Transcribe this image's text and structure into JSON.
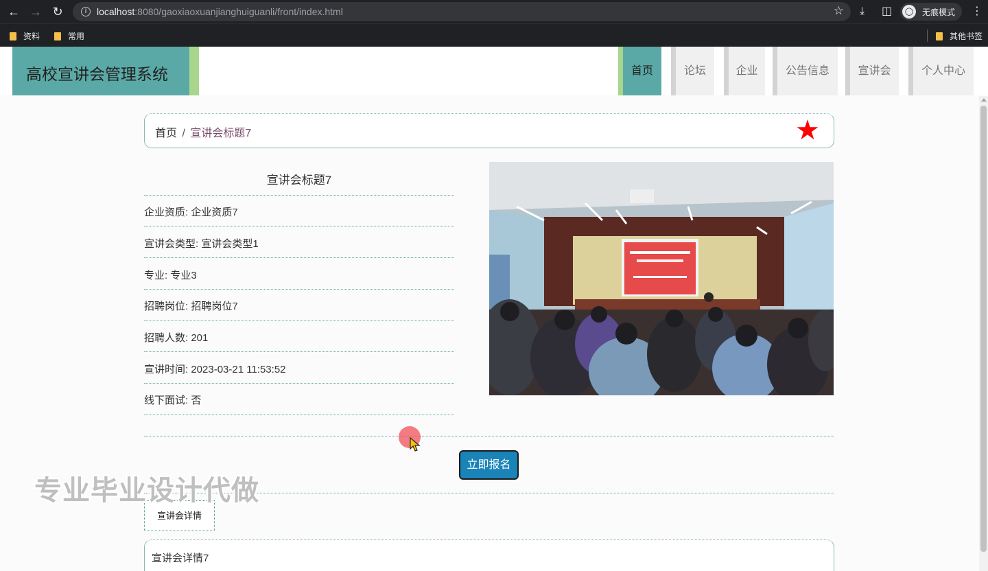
{
  "browser": {
    "url_host": "localhost",
    "url_rest": ":8080/gaoxiaoxuanjianghuiguanli/front/index.html",
    "incognito_label": "无痕模式",
    "bookmarks": [
      "资料",
      "常用"
    ],
    "other_bookmarks": "其他书签"
  },
  "site": {
    "title": "高校宣讲会管理系统",
    "nav": [
      "首页",
      "论坛",
      "企业",
      "公告信息",
      "宣讲会",
      "个人中心"
    ],
    "nav_active": "首页",
    "accent_color": "#5aa9a6",
    "accent_light": "#a8d68c"
  },
  "breadcrumb": {
    "home": "首页",
    "separator": "/",
    "current": "宣讲会标题7"
  },
  "info": {
    "title": "宣讲会标题7",
    "rows": [
      "企业资质: 企业资质7",
      "宣讲会类型: 宣讲会类型1",
      "专业: 专业3",
      "招聘岗位: 招聘岗位7",
      "招聘人数: 201",
      "宣讲时间: 2023-03-21 11:53:52",
      "线下面试: 否"
    ]
  },
  "actions": {
    "signup_label": "立即报名"
  },
  "detail": {
    "tab_label": "宣讲会详情",
    "content": "宣讲会详情7"
  },
  "watermark": "专业毕业设计代做"
}
